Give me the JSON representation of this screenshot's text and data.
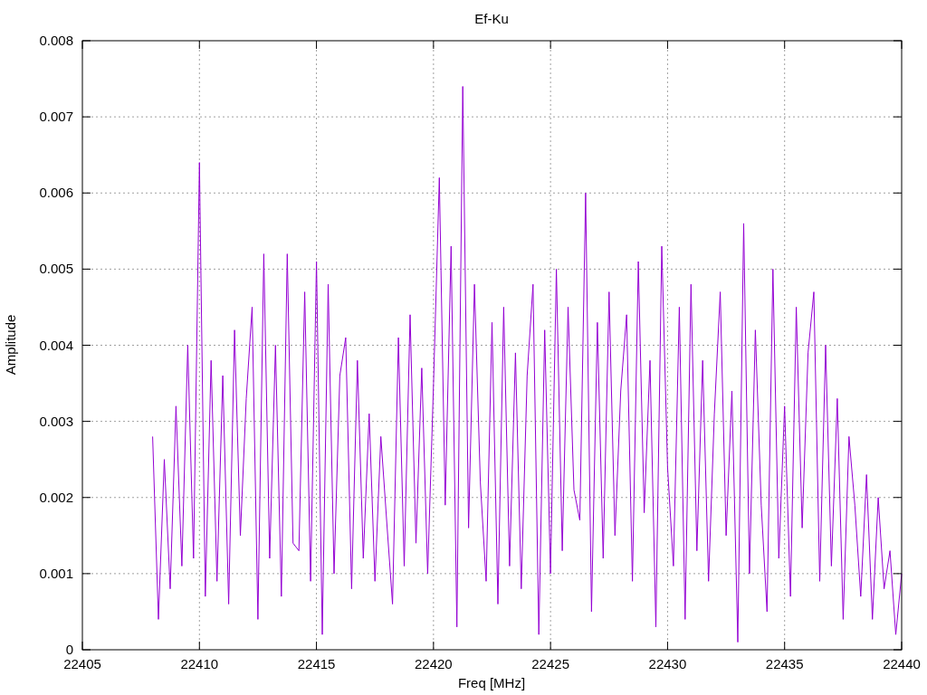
{
  "plot": {
    "chart_data": {
      "type": "line",
      "title": "Ef-Ku",
      "xlabel": "Freq [MHz]",
      "ylabel": "Amplitude",
      "x": [
        22408,
        22408.25,
        22408.5,
        22408.75,
        22409,
        22409.25,
        22409.5,
        22409.75,
        22410,
        22410.25,
        22410.5,
        22410.75,
        22411,
        22411.25,
        22411.5,
        22411.75,
        22412,
        22412.25,
        22412.5,
        22412.75,
        22413,
        22413.25,
        22413.5,
        22413.75,
        22414,
        22414.25,
        22414.5,
        22414.75,
        22415,
        22415.25,
        22415.5,
        22415.75,
        22416,
        22416.25,
        22416.5,
        22416.75,
        22417,
        22417.25,
        22417.5,
        22417.75,
        22418,
        22418.25,
        22418.5,
        22418.75,
        22419,
        22419.25,
        22419.5,
        22419.75,
        22420,
        22420.25,
        22420.5,
        22420.75,
        22421,
        22421.25,
        22421.5,
        22421.75,
        22422,
        22422.25,
        22422.5,
        22422.75,
        22423,
        22423.25,
        22423.5,
        22423.75,
        22424,
        22424.25,
        22424.5,
        22424.75,
        22425,
        22425.25,
        22425.5,
        22425.75,
        22426,
        22426.25,
        22426.5,
        22426.75,
        22427,
        22427.25,
        22427.5,
        22427.75,
        22428,
        22428.25,
        22428.5,
        22428.75,
        22429,
        22429.25,
        22429.5,
        22429.75,
        22430,
        22430.25,
        22430.5,
        22430.75,
        22431,
        22431.25,
        22431.5,
        22431.75,
        22432,
        22432.25,
        22432.5,
        22432.75,
        22433,
        22433.25,
        22433.5,
        22433.75,
        22434,
        22434.25,
        22434.5,
        22434.75,
        22435,
        22435.25,
        22435.5,
        22435.75,
        22436,
        22436.25,
        22436.5,
        22436.75,
        22437,
        22437.25,
        22437.5,
        22437.75,
        22438,
        22438.25,
        22438.5,
        22438.75,
        22439,
        22439.25,
        22439.5,
        22439.75,
        22440
      ],
      "series": [
        {
          "color": "#9400d3",
          "values": [
            0.0028,
            0.0004,
            0.0025,
            0.0008,
            0.0032,
            0.0011,
            0.004,
            0.0012,
            0.0064,
            0.0007,
            0.0038,
            0.0009,
            0.0036,
            0.0006,
            0.0042,
            0.0015,
            0.0033,
            0.0045,
            0.0004,
            0.0052,
            0.0012,
            0.004,
            0.0007,
            0.0052,
            0.0014,
            0.0013,
            0.0047,
            0.0009,
            0.0051,
            0.0002,
            0.0048,
            0.001,
            0.0036,
            0.0041,
            0.0008,
            0.0038,
            0.0012,
            0.0031,
            0.0009,
            0.0028,
            0.0017,
            0.0006,
            0.0041,
            0.0011,
            0.0044,
            0.0014,
            0.0037,
            0.001,
            0.0035,
            0.0062,
            0.0019,
            0.0053,
            0.0003,
            0.0074,
            0.0016,
            0.0048,
            0.0022,
            0.0009,
            0.0043,
            0.0006,
            0.0045,
            0.0011,
            0.0039,
            0.0008,
            0.0036,
            0.0048,
            0.0002,
            0.0042,
            0.001,
            0.005,
            0.0013,
            0.0045,
            0.0021,
            0.0017,
            0.006,
            0.0005,
            0.0043,
            0.0012,
            0.0047,
            0.0015,
            0.0034,
            0.0044,
            0.0009,
            0.0051,
            0.0018,
            0.0038,
            0.0003,
            0.0053,
            0.0024,
            0.0011,
            0.0045,
            0.0004,
            0.0048,
            0.0013,
            0.0038,
            0.0009,
            0.0031,
            0.0047,
            0.0015,
            0.0034,
            0.0001,
            0.0056,
            0.001,
            0.0042,
            0.0019,
            0.0005,
            0.005,
            0.0012,
            0.0032,
            0.0007,
            0.0045,
            0.0016,
            0.0039,
            0.0047,
            0.0009,
            0.004,
            0.0011,
            0.0033,
            0.0004,
            0.0028,
            0.0019,
            0.0007,
            0.0023,
            0.0004,
            0.002,
            0.0008,
            0.0013,
            0.0002,
            0.001
          ]
        }
      ],
      "xlim": [
        22405,
        22440
      ],
      "ylim": [
        0,
        0.008
      ],
      "grid": true,
      "xticks": [
        22405,
        22410,
        22415,
        22420,
        22425,
        22430,
        22435,
        22440
      ],
      "yticks": [
        0,
        0.001,
        0.002,
        0.003,
        0.004,
        0.005,
        0.006,
        0.007,
        0.008
      ]
    }
  }
}
